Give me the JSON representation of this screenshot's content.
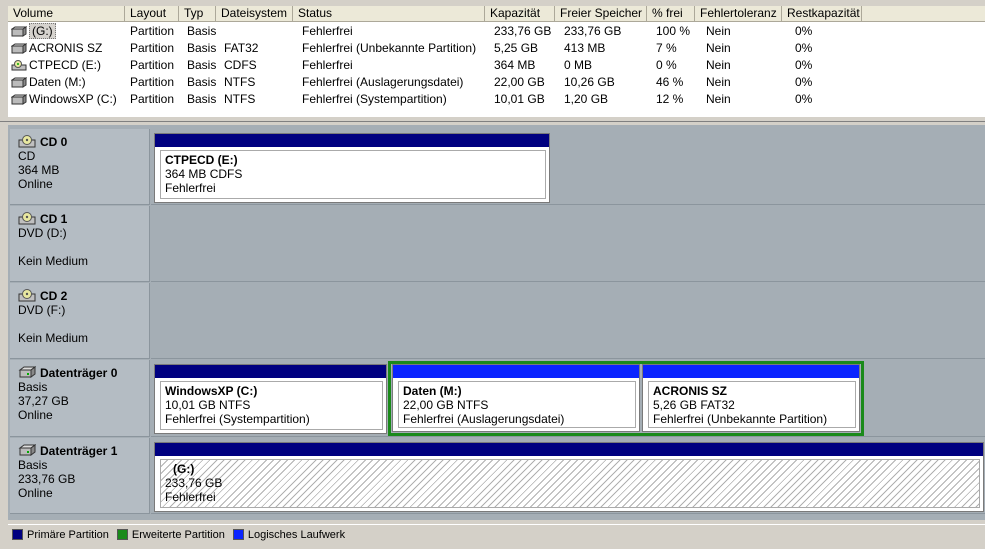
{
  "volume_list": {
    "columns": [
      "Volume",
      "Layout",
      "Typ",
      "Dateisystem",
      "Status",
      "Kapazität",
      "Freier Speicher",
      "% frei",
      "Fehlertoleranz",
      "Restkapazität"
    ],
    "rows": [
      {
        "volume": "(G:)",
        "icon": "hard-drive-icon",
        "layout": "Partition",
        "typ": "Basis",
        "fs": "",
        "status": "Fehlerfrei",
        "kapazitaet": "233,76 GB",
        "frei": "233,76 GB",
        "pfrei": "100 %",
        "fehlertoleranz": "Nein",
        "rest": "0%"
      },
      {
        "volume": "ACRONIS SZ",
        "icon": "hard-drive-icon",
        "layout": "Partition",
        "typ": "Basis",
        "fs": "FAT32",
        "status": "Fehlerfrei (Unbekannte Partition)",
        "kapazitaet": "5,25 GB",
        "frei": "413 MB",
        "pfrei": "7 %",
        "fehlertoleranz": "Nein",
        "rest": "0%"
      },
      {
        "volume": "CTPECD (E:)",
        "icon": "cd-drive-icon",
        "layout": "Partition",
        "typ": "Basis",
        "fs": "CDFS",
        "status": "Fehlerfrei",
        "kapazitaet": "364 MB",
        "frei": "0 MB",
        "pfrei": "0 %",
        "fehlertoleranz": "Nein",
        "rest": "0%"
      },
      {
        "volume": "Daten (M:)",
        "icon": "hard-drive-icon",
        "layout": "Partition",
        "typ": "Basis",
        "fs": "NTFS",
        "status": "Fehlerfrei (Auslagerungsdatei)",
        "kapazitaet": "22,00 GB",
        "frei": "10,26 GB",
        "pfrei": "46 %",
        "fehlertoleranz": "Nein",
        "rest": "0%"
      },
      {
        "volume": "WindowsXP (C:)",
        "icon": "hard-drive-icon",
        "layout": "Partition",
        "typ": "Basis",
        "fs": "NTFS",
        "status": "Fehlerfrei (Systempartition)",
        "kapazitaet": "10,01 GB",
        "frei": "1,20 GB",
        "pfrei": "12 %",
        "fehlertoleranz": "Nein",
        "rest": "0%"
      }
    ]
  },
  "disks": [
    {
      "name": "CD 0",
      "icon": "cd-drive-icon",
      "line1": "CD",
      "line2": "364 MB",
      "line3": "Online",
      "partitions": [
        {
          "name": "CTPECD  (E:)",
          "line1": "364 MB CDFS",
          "line2": "Fehlerfrei",
          "kind": "primary"
        }
      ]
    },
    {
      "name": "CD 1",
      "icon": "cd-drive-icon",
      "line1": "DVD (D:)",
      "line2": "",
      "line3": "Kein Medium",
      "partitions": []
    },
    {
      "name": "CD 2",
      "icon": "cd-drive-icon",
      "line1": "DVD (F:)",
      "line2": "",
      "line3": "Kein Medium",
      "partitions": []
    },
    {
      "name": "Datenträger 0",
      "icon": "hard-drive-icon",
      "line1": "Basis",
      "line2": "37,27 GB",
      "line3": "Online",
      "partitions": [
        {
          "name": "WindowsXP  (C:)",
          "line1": "10,01 GB NTFS",
          "line2": "Fehlerfrei (Systempartition)",
          "kind": "primary"
        },
        {
          "name": "Daten  (M:)",
          "line1": "22,00 GB NTFS",
          "line2": "Fehlerfrei (Auslagerungsdatei)",
          "kind": "logical"
        },
        {
          "name": "ACRONIS SZ",
          "line1": "5,26 GB FAT32",
          "line2": "Fehlerfrei (Unbekannte Partition)",
          "kind": "logical"
        }
      ]
    },
    {
      "name": "Datenträger 1",
      "icon": "hard-drive-icon",
      "line1": "Basis",
      "line2": "233,76 GB",
      "line3": "Online",
      "partitions": [
        {
          "name": "(G:)",
          "line1": "233,76 GB",
          "line2": "Fehlerfrei",
          "kind": "primary"
        }
      ]
    }
  ],
  "legend": [
    {
      "label": "Primäre Partition",
      "color": "#000080"
    },
    {
      "label": "Erweiterte Partition",
      "color": "#1a8a1a"
    },
    {
      "label": "Logisches Laufwerk",
      "color": "#0a24ff"
    }
  ],
  "colors": {
    "primary": "#000080",
    "extended": "#1a8a1a",
    "logical": "#0a24ff"
  }
}
